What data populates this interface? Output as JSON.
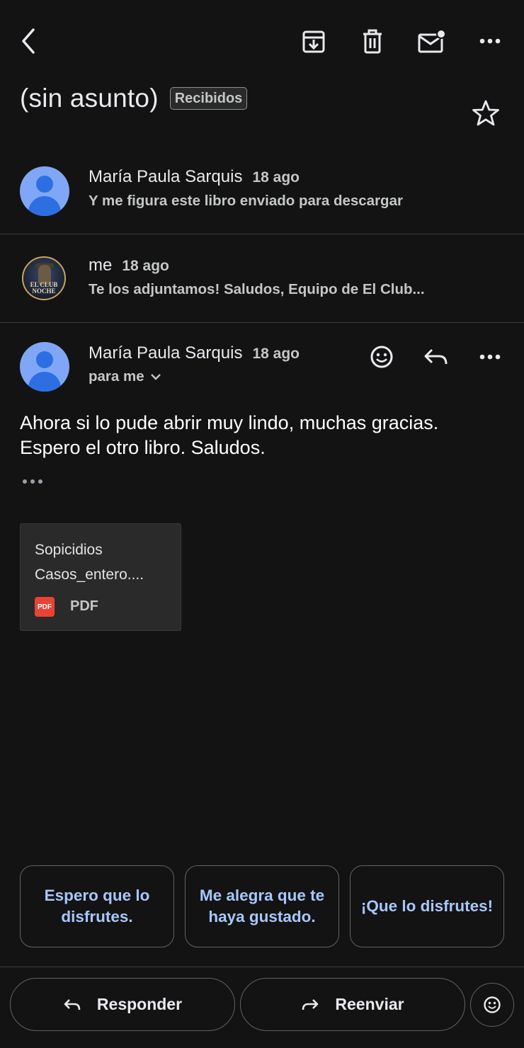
{
  "toolbar": {
    "icons": [
      "back-arrow-icon",
      "archive-icon",
      "trash-icon",
      "mark-unread-icon",
      "more-horizontal-icon"
    ]
  },
  "thread": {
    "subject": "(sin asunto)",
    "label": "Recibidos"
  },
  "messages": [
    {
      "sender": "María Paula Sarquis",
      "time": "18 ago",
      "snippet": "Y me figura este libro enviado para descargar"
    },
    {
      "sender": "me",
      "time": "18 ago",
      "snippet": "Te los adjuntamos! Saludos, Equipo de El Club...",
      "avatar_text": [
        "EL CLUB",
        "NOCHE"
      ]
    }
  ],
  "expanded": {
    "sender": "María Paula Sarquis",
    "time": "18 ago",
    "recipient": "para me",
    "body_lines": [
      "Ahora si lo pude abrir muy lindo, muchas gracias.",
      "Espero el otro libro. Saludos."
    ],
    "attachment": {
      "name_line1": "Sopicidios",
      "name_line2": "Casos_entero....",
      "badge": "PDF",
      "type": "PDF"
    }
  },
  "smart_replies": [
    "Espero que lo disfrutes.",
    "Me alegra que te haya gustado.",
    "¡Que lo disfrutes!"
  ],
  "actions": {
    "reply": "Responder",
    "forward": "Reenviar"
  },
  "colors": {
    "background": "#131314",
    "link_accent": "#a8c7fa",
    "avatar": "#7fa7f5",
    "pdf": "#ea4335"
  }
}
